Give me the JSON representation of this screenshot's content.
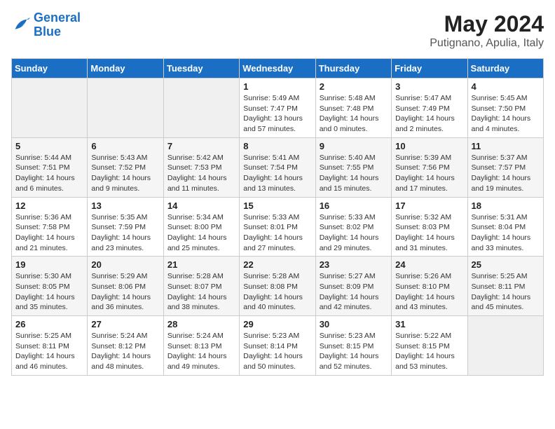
{
  "logo": {
    "text_general": "General",
    "text_blue": "Blue"
  },
  "header": {
    "month_year": "May 2024",
    "location": "Putignano, Apulia, Italy"
  },
  "weekdays": [
    "Sunday",
    "Monday",
    "Tuesday",
    "Wednesday",
    "Thursday",
    "Friday",
    "Saturday"
  ],
  "weeks": [
    [
      {
        "day": "",
        "sunrise": "",
        "sunset": "",
        "daylight": ""
      },
      {
        "day": "",
        "sunrise": "",
        "sunset": "",
        "daylight": ""
      },
      {
        "day": "",
        "sunrise": "",
        "sunset": "",
        "daylight": ""
      },
      {
        "day": "1",
        "sunrise": "Sunrise: 5:49 AM",
        "sunset": "Sunset: 7:47 PM",
        "daylight": "Daylight: 13 hours and 57 minutes."
      },
      {
        "day": "2",
        "sunrise": "Sunrise: 5:48 AM",
        "sunset": "Sunset: 7:48 PM",
        "daylight": "Daylight: 14 hours and 0 minutes."
      },
      {
        "day": "3",
        "sunrise": "Sunrise: 5:47 AM",
        "sunset": "Sunset: 7:49 PM",
        "daylight": "Daylight: 14 hours and 2 minutes."
      },
      {
        "day": "4",
        "sunrise": "Sunrise: 5:45 AM",
        "sunset": "Sunset: 7:50 PM",
        "daylight": "Daylight: 14 hours and 4 minutes."
      }
    ],
    [
      {
        "day": "5",
        "sunrise": "Sunrise: 5:44 AM",
        "sunset": "Sunset: 7:51 PM",
        "daylight": "Daylight: 14 hours and 6 minutes."
      },
      {
        "day": "6",
        "sunrise": "Sunrise: 5:43 AM",
        "sunset": "Sunset: 7:52 PM",
        "daylight": "Daylight: 14 hours and 9 minutes."
      },
      {
        "day": "7",
        "sunrise": "Sunrise: 5:42 AM",
        "sunset": "Sunset: 7:53 PM",
        "daylight": "Daylight: 14 hours and 11 minutes."
      },
      {
        "day": "8",
        "sunrise": "Sunrise: 5:41 AM",
        "sunset": "Sunset: 7:54 PM",
        "daylight": "Daylight: 14 hours and 13 minutes."
      },
      {
        "day": "9",
        "sunrise": "Sunrise: 5:40 AM",
        "sunset": "Sunset: 7:55 PM",
        "daylight": "Daylight: 14 hours and 15 minutes."
      },
      {
        "day": "10",
        "sunrise": "Sunrise: 5:39 AM",
        "sunset": "Sunset: 7:56 PM",
        "daylight": "Daylight: 14 hours and 17 minutes."
      },
      {
        "day": "11",
        "sunrise": "Sunrise: 5:37 AM",
        "sunset": "Sunset: 7:57 PM",
        "daylight": "Daylight: 14 hours and 19 minutes."
      }
    ],
    [
      {
        "day": "12",
        "sunrise": "Sunrise: 5:36 AM",
        "sunset": "Sunset: 7:58 PM",
        "daylight": "Daylight: 14 hours and 21 minutes."
      },
      {
        "day": "13",
        "sunrise": "Sunrise: 5:35 AM",
        "sunset": "Sunset: 7:59 PM",
        "daylight": "Daylight: 14 hours and 23 minutes."
      },
      {
        "day": "14",
        "sunrise": "Sunrise: 5:34 AM",
        "sunset": "Sunset: 8:00 PM",
        "daylight": "Daylight: 14 hours and 25 minutes."
      },
      {
        "day": "15",
        "sunrise": "Sunrise: 5:33 AM",
        "sunset": "Sunset: 8:01 PM",
        "daylight": "Daylight: 14 hours and 27 minutes."
      },
      {
        "day": "16",
        "sunrise": "Sunrise: 5:33 AM",
        "sunset": "Sunset: 8:02 PM",
        "daylight": "Daylight: 14 hours and 29 minutes."
      },
      {
        "day": "17",
        "sunrise": "Sunrise: 5:32 AM",
        "sunset": "Sunset: 8:03 PM",
        "daylight": "Daylight: 14 hours and 31 minutes."
      },
      {
        "day": "18",
        "sunrise": "Sunrise: 5:31 AM",
        "sunset": "Sunset: 8:04 PM",
        "daylight": "Daylight: 14 hours and 33 minutes."
      }
    ],
    [
      {
        "day": "19",
        "sunrise": "Sunrise: 5:30 AM",
        "sunset": "Sunset: 8:05 PM",
        "daylight": "Daylight: 14 hours and 35 minutes."
      },
      {
        "day": "20",
        "sunrise": "Sunrise: 5:29 AM",
        "sunset": "Sunset: 8:06 PM",
        "daylight": "Daylight: 14 hours and 36 minutes."
      },
      {
        "day": "21",
        "sunrise": "Sunrise: 5:28 AM",
        "sunset": "Sunset: 8:07 PM",
        "daylight": "Daylight: 14 hours and 38 minutes."
      },
      {
        "day": "22",
        "sunrise": "Sunrise: 5:28 AM",
        "sunset": "Sunset: 8:08 PM",
        "daylight": "Daylight: 14 hours and 40 minutes."
      },
      {
        "day": "23",
        "sunrise": "Sunrise: 5:27 AM",
        "sunset": "Sunset: 8:09 PM",
        "daylight": "Daylight: 14 hours and 42 minutes."
      },
      {
        "day": "24",
        "sunrise": "Sunrise: 5:26 AM",
        "sunset": "Sunset: 8:10 PM",
        "daylight": "Daylight: 14 hours and 43 minutes."
      },
      {
        "day": "25",
        "sunrise": "Sunrise: 5:25 AM",
        "sunset": "Sunset: 8:11 PM",
        "daylight": "Daylight: 14 hours and 45 minutes."
      }
    ],
    [
      {
        "day": "26",
        "sunrise": "Sunrise: 5:25 AM",
        "sunset": "Sunset: 8:11 PM",
        "daylight": "Daylight: 14 hours and 46 minutes."
      },
      {
        "day": "27",
        "sunrise": "Sunrise: 5:24 AM",
        "sunset": "Sunset: 8:12 PM",
        "daylight": "Daylight: 14 hours and 48 minutes."
      },
      {
        "day": "28",
        "sunrise": "Sunrise: 5:24 AM",
        "sunset": "Sunset: 8:13 PM",
        "daylight": "Daylight: 14 hours and 49 minutes."
      },
      {
        "day": "29",
        "sunrise": "Sunrise: 5:23 AM",
        "sunset": "Sunset: 8:14 PM",
        "daylight": "Daylight: 14 hours and 50 minutes."
      },
      {
        "day": "30",
        "sunrise": "Sunrise: 5:23 AM",
        "sunset": "Sunset: 8:15 PM",
        "daylight": "Daylight: 14 hours and 52 minutes."
      },
      {
        "day": "31",
        "sunrise": "Sunrise: 5:22 AM",
        "sunset": "Sunset: 8:15 PM",
        "daylight": "Daylight: 14 hours and 53 minutes."
      },
      {
        "day": "",
        "sunrise": "",
        "sunset": "",
        "daylight": ""
      }
    ]
  ]
}
